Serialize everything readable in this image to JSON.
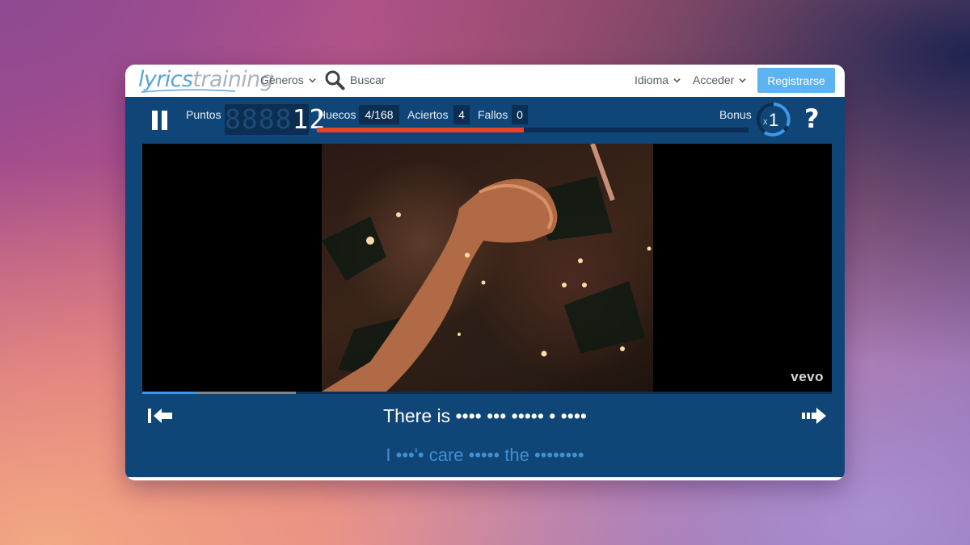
{
  "nav": {
    "logo_part1": "lyrics",
    "logo_part2": "training",
    "genres_label": "Géneros",
    "search_label": "Buscar",
    "language_label": "Idioma",
    "login_label": "Acceder",
    "register_label": "Registrarse"
  },
  "game": {
    "points_label": "Puntos",
    "points_ghost": "8888",
    "points_value": "12",
    "gaps_label": "Huecos",
    "gaps_value": "4/168",
    "hits_label": "Aciertos",
    "hits_value": "4",
    "misses_label": "Fallos",
    "misses_value": "0",
    "progress_fraction": 0.48,
    "bonus_label": "Bonus",
    "bonus_prefix": "x",
    "bonus_value": "1",
    "help_label": "?"
  },
  "video": {
    "brand_watermark": "vevo",
    "played_fraction": 0.077,
    "buffered_fraction": 0.223
  },
  "lyrics": {
    "current_line": "There is •••• ••• ••••• • ••••",
    "next_line": "I •••'• care ••••• the ••••••••"
  },
  "colors": {
    "panel": "#0f4677",
    "accent_blue": "#5db3ef",
    "progress_red": "#e9412e"
  },
  "icons": {
    "pause": "pause-icon",
    "search": "search-icon",
    "previous_line": "skip-back-icon",
    "next_line": "skip-forward-icon",
    "help": "question-mark-icon"
  }
}
